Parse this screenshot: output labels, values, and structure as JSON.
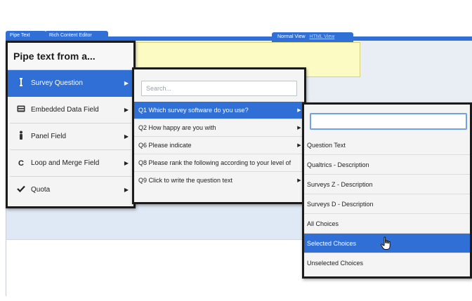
{
  "editor": {
    "tab_left": "Pipe Text",
    "tab_left2": "Rich Content Editor",
    "view_normal": "Normal View",
    "view_html": "HTML View"
  },
  "menu1": {
    "title": "Pipe text from a...",
    "items": [
      {
        "label": "Survey Question",
        "icon": "survey-question-icon"
      },
      {
        "label": "Embedded Data Field",
        "icon": "embedded-data-icon"
      },
      {
        "label": "Panel Field",
        "icon": "panel-field-icon"
      },
      {
        "label": "Loop and Merge Field",
        "icon": "loop-merge-icon"
      },
      {
        "label": "Quota",
        "icon": "checkmark-icon"
      }
    ],
    "active_index": 0
  },
  "menu2": {
    "search_placeholder": "Search...",
    "items": [
      {
        "label": "Q1 Which survey software do you use?"
      },
      {
        "label": "Q2 How happy are you with"
      },
      {
        "label": "Q6 Please indicate"
      },
      {
        "label": "Q8 Please rank the following according to your level of"
      },
      {
        "label": "Q9 Click to write the question text"
      }
    ],
    "active_index": 0
  },
  "menu3": {
    "input_value": "",
    "items": [
      {
        "label": "Question Text"
      },
      {
        "label": "Qualtrics - Description"
      },
      {
        "label": "Surveys Z - Description"
      },
      {
        "label": "Surveys D - Description"
      },
      {
        "label": "All Choices"
      },
      {
        "label": "Selected Choices"
      },
      {
        "label": "Unselected Choices"
      }
    ],
    "active_index": 5
  },
  "colors": {
    "accent": "#2f6fd6",
    "panel_border": "#1b1b1b",
    "yellow_box": "#fdfbc4"
  }
}
